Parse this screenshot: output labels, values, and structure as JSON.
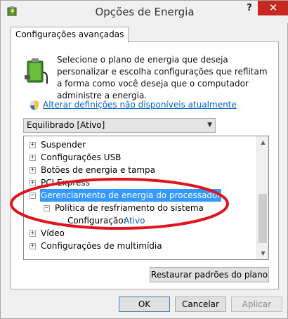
{
  "window": {
    "title": "Opções de Energia",
    "help_label": "?",
    "close_label": "✕"
  },
  "tab": {
    "label": "Configurações avançadas"
  },
  "description": "Selecione o plano de energia que deseja personalizar e escolha configurações que reflitam a forma como você deseja que o computador administre a energia.",
  "link": {
    "label": "Alterar definições não disponíveis atualmente"
  },
  "plan_select": {
    "value": "Equilibrado [Ativo]",
    "arrow": "▼"
  },
  "tree": {
    "items": [
      {
        "label": "Suspender",
        "expander": "+"
      },
      {
        "label": "Configurações USB",
        "expander": "+"
      },
      {
        "label": "Botões de energia e tampa",
        "expander": "+"
      },
      {
        "label": "PCI Express",
        "expander": "+"
      },
      {
        "label": "Gerenciamento de energia do processador",
        "expander": "−"
      },
      {
        "label": "Política de resfriamento do sistema",
        "expander": "−"
      },
      {
        "label": "Configuração:",
        "value": "Ativo"
      },
      {
        "label": "Vídeo",
        "expander": "+"
      },
      {
        "label": "Configurações de multimídia",
        "expander": "+"
      }
    ]
  },
  "scrollbar": {
    "up": "▲",
    "down": "▼"
  },
  "buttons": {
    "restore": "Restaurar padrões do plano",
    "ok": "OK",
    "cancel": "Cancelar",
    "apply": "Aplicar"
  },
  "colors": {
    "selection": "#3399ff",
    "link": "#0062c4",
    "annotation": "#e0141e",
    "close_button": "#c7281f"
  }
}
